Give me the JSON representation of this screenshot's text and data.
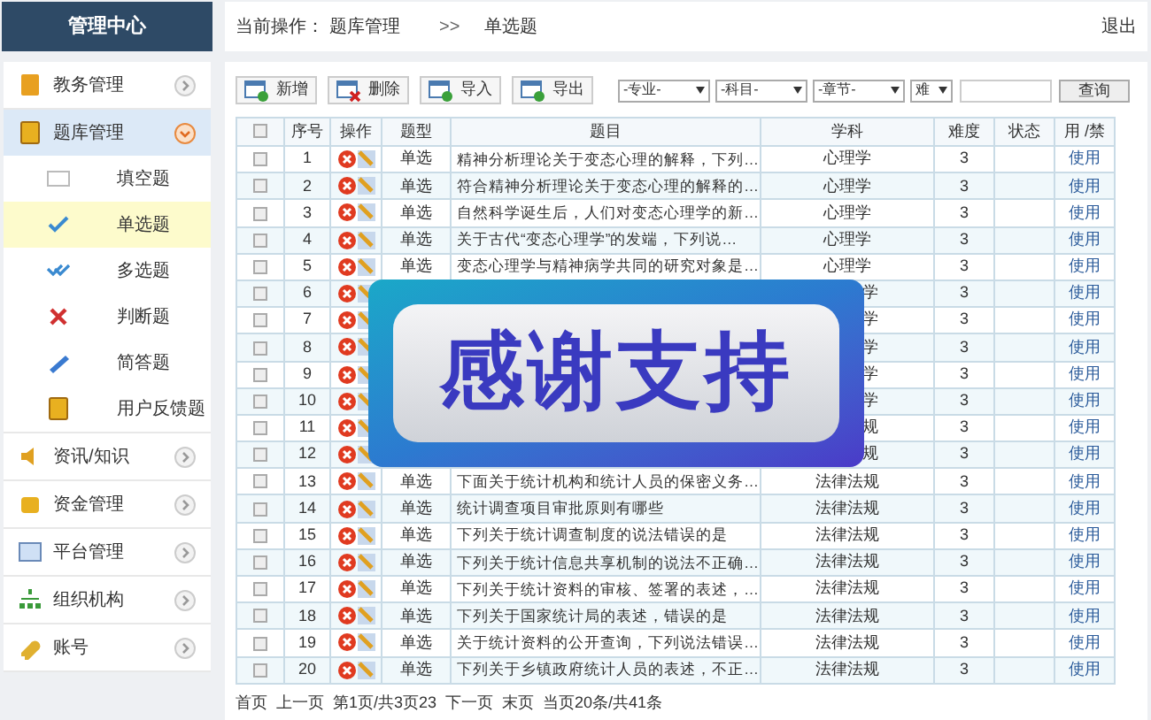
{
  "sidebar": {
    "title": "管理中心",
    "items": [
      {
        "label": "教务管理",
        "expanded": false
      },
      {
        "label": "题库管理",
        "expanded": true,
        "children": [
          {
            "label": "填空题",
            "selected": false
          },
          {
            "label": "单选题",
            "selected": true
          },
          {
            "label": "多选题",
            "selected": false
          },
          {
            "label": "判断题",
            "selected": false
          },
          {
            "label": "简答题",
            "selected": false
          },
          {
            "label": "用户反馈题",
            "selected": false
          }
        ]
      },
      {
        "label": "资讯/知识",
        "expanded": false
      },
      {
        "label": "资金管理",
        "expanded": false
      },
      {
        "label": "平台管理",
        "expanded": false
      },
      {
        "label": "组织机构",
        "expanded": false
      },
      {
        "label": "账号",
        "expanded": false
      }
    ]
  },
  "breadcrumb": {
    "prefix": "当前操作：",
    "section": "题库管理",
    "separator": ">>",
    "page": "单选题"
  },
  "logout": "退出",
  "toolbar": {
    "buttons": [
      {
        "label": "新增",
        "kind": "add"
      },
      {
        "label": "删除",
        "kind": "delete"
      },
      {
        "label": "导入",
        "kind": "add"
      },
      {
        "label": "导出",
        "kind": "add"
      }
    ],
    "selects": [
      "-专业-",
      "-科目-",
      "-章节-",
      "难"
    ],
    "search_button": "查询"
  },
  "table": {
    "all_checked": false,
    "columns": [
      "序号",
      "操作",
      "题型",
      "题目",
      "学科",
      "难度",
      "状态",
      "用 /禁"
    ],
    "rows": [
      {
        "no": "1",
        "type": "单选",
        "title": "精神分析理论关于变态心理的解释，下列…",
        "subject": "心理学",
        "difficulty": "3",
        "action": "使用",
        "checked": false
      },
      {
        "no": "2",
        "type": "单选",
        "title": "符合精神分析理论关于变态心理的解释的…",
        "subject": "心理学",
        "difficulty": "3",
        "action": "使用",
        "checked": false
      },
      {
        "no": "3",
        "type": "单选",
        "title": "自然科学诞生后，人们对变态心理学的新…",
        "subject": "心理学",
        "difficulty": "3",
        "action": "使用",
        "checked": false
      },
      {
        "no": "4",
        "type": "单选",
        "title": "关于古代“变态心理学”的发端，下列说…",
        "subject": "心理学",
        "difficulty": "3",
        "action": "使用",
        "checked": false
      },
      {
        "no": "5",
        "type": "单选",
        "title": "变态心理学与精神病学共同的研究对象是…",
        "subject": "心理学",
        "difficulty": "3",
        "action": "使用",
        "checked": false
      },
      {
        "no": "6",
        "kind": "covered",
        "subject": "学",
        "difficulty": "3",
        "action": "使用",
        "checked": false
      },
      {
        "no": "7",
        "kind": "covered",
        "subject": "学",
        "difficulty": "3",
        "action": "使用",
        "checked": false
      },
      {
        "no": "8",
        "kind": "covered",
        "subject": "学",
        "difficulty": "3",
        "action": "使用",
        "checked": false
      },
      {
        "no": "9",
        "kind": "covered",
        "subject": "学",
        "difficulty": "3",
        "action": "使用",
        "checked": false
      },
      {
        "no": "10",
        "kind": "covered",
        "subject": "学",
        "difficulty": "3",
        "action": "使用",
        "checked": false
      },
      {
        "no": "11",
        "kind": "covered",
        "subject": "规",
        "difficulty": "3",
        "action": "使用",
        "checked": false
      },
      {
        "no": "12",
        "kind": "covered",
        "subject": "规",
        "difficulty": "3",
        "action": "使用",
        "checked": false
      },
      {
        "no": "13",
        "type": "单选",
        "title": "下面关于统计机构和统计人员的保密义务…",
        "subject": "法律法规",
        "difficulty": "3",
        "action": "使用",
        "checked": false
      },
      {
        "no": "14",
        "type": "单选",
        "title": "统计调查项目审批原则有哪些",
        "subject": "法律法规",
        "difficulty": "3",
        "action": "使用",
        "checked": false
      },
      {
        "no": "15",
        "type": "单选",
        "title": "下列关于统计调查制度的说法错误的是",
        "subject": "法律法规",
        "difficulty": "3",
        "action": "使用",
        "checked": false
      },
      {
        "no": "16",
        "type": "单选",
        "title": "下列关于统计信息共享机制的说法不正确…",
        "subject": "法律法规",
        "difficulty": "3",
        "action": "使用",
        "checked": false
      },
      {
        "no": "17",
        "type": "单选",
        "title": "下列关于统计资料的审核、签署的表述，…",
        "subject": "法律法规",
        "difficulty": "3",
        "action": "使用",
        "checked": false
      },
      {
        "no": "18",
        "type": "单选",
        "title": "下列关于国家统计局的表述，错误的是",
        "subject": "法律法规",
        "difficulty": "3",
        "action": "使用",
        "checked": false
      },
      {
        "no": "19",
        "type": "单选",
        "title": "关于统计资料的公开查询，下列说法错误…",
        "subject": "法律法规",
        "difficulty": "3",
        "action": "使用",
        "checked": false
      },
      {
        "no": "20",
        "type": "单选",
        "title": "下列关于乡镇政府统计人员的表述，不正…",
        "subject": "法律法规",
        "difficulty": "3",
        "action": "使用",
        "checked": false
      }
    ]
  },
  "pagination": {
    "items": [
      "首页",
      "上一页",
      "第1页/共3页23",
      "下一页",
      "末页",
      "当页20条/共41条"
    ]
  },
  "overlay": {
    "text": "感谢支持"
  }
}
